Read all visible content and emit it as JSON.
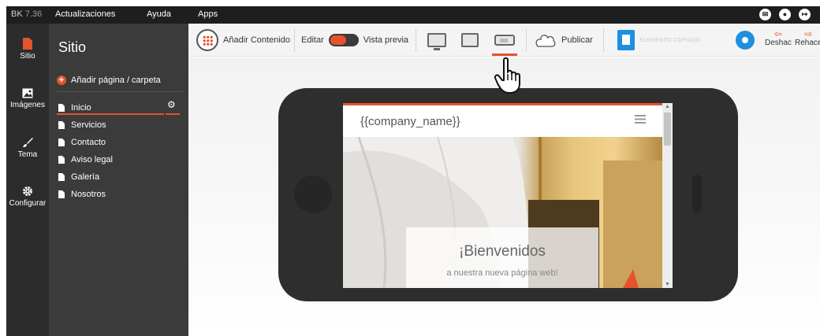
{
  "topbar": {
    "brand": "BK",
    "version": "7.36",
    "menu": [
      "Actualizaciones",
      "Ayuda",
      "Apps"
    ],
    "icons": [
      "mail-icon",
      "user-icon",
      "logout-icon"
    ]
  },
  "rail": {
    "items": [
      {
        "label": "Sitio",
        "icon": "page-icon",
        "active": true
      },
      {
        "label": "Imágenes",
        "icon": "image-icon"
      },
      {
        "label": "Tema",
        "icon": "brush-icon"
      },
      {
        "label": "Configurar",
        "icon": "gear-icon"
      }
    ]
  },
  "panel": {
    "title": "Sitio",
    "add_page": "Añadir página / carpeta",
    "pages": [
      "Inicio",
      "Servicios",
      "Contacto",
      "Aviso legal",
      "Galería",
      "Nosotros"
    ]
  },
  "toolbar": {
    "add_content": "Añadir Contenido",
    "edit": "Editar",
    "preview": "Vista previa",
    "publish": "Publicar",
    "copied": "ELEMENTO COPIADO",
    "undo": "Deshac",
    "redo": "Rehace"
  },
  "preview": {
    "company_name": "{{company_name}}",
    "welcome_title": "¡Bienvenidos",
    "welcome_subtitle": "a nuestra nueva página web!"
  },
  "colors": {
    "accent": "#e5532d",
    "blue": "#1e90e0",
    "dark": "#1e1e1e"
  }
}
